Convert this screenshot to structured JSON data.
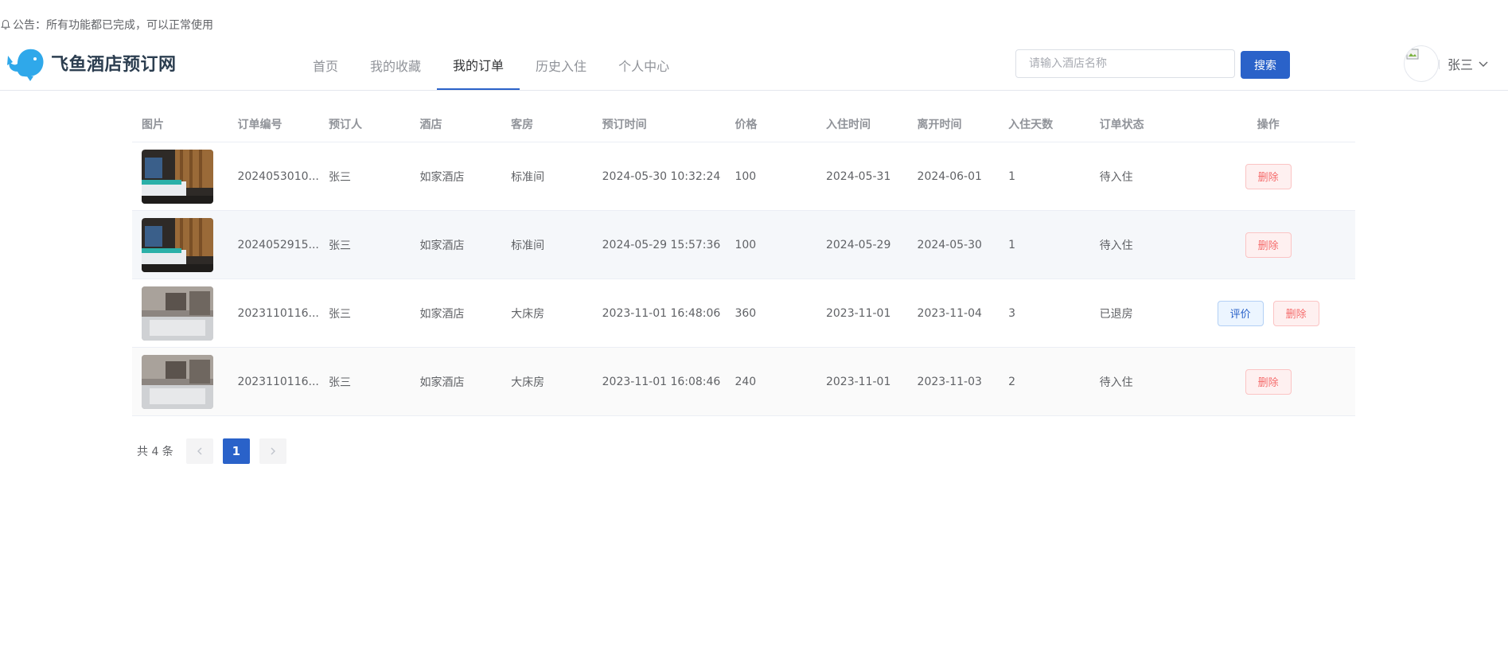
{
  "notice": {
    "text": "公告：所有功能都已完成，可以正常使用"
  },
  "brand": {
    "name": "飞鱼酒店预订网",
    "accent": "#2a62c9",
    "logo_color": "#2fa8ea"
  },
  "nav": [
    {
      "label": "首页",
      "active": false
    },
    {
      "label": "我的收藏",
      "active": false
    },
    {
      "label": "我的订单",
      "active": true
    },
    {
      "label": "历史入住",
      "active": false
    },
    {
      "label": "个人中心",
      "active": false
    }
  ],
  "search": {
    "placeholder": "请输入酒店名称",
    "value": "",
    "button": "搜索"
  },
  "user": {
    "name": "张三",
    "avatar_icon": "broken-image-icon",
    "menu_icon": "chevron-down-icon"
  },
  "table": {
    "headers": [
      "图片",
      "订单编号",
      "预订人",
      "酒店",
      "客房",
      "预订时间",
      "价格",
      "入住时间",
      "离开时间",
      "入住天数",
      "订单状态",
      "操作"
    ],
    "rows": [
      {
        "image": "standard-room",
        "order_no": "2024053010...",
        "guest": "张三",
        "hotel": "如家酒店",
        "room": "标准间",
        "booked": "2024-05-30 10:32:24",
        "price": "100",
        "checkin": "2024-05-31",
        "checkout": "2024-06-01",
        "days": "1",
        "status": "待入住",
        "actions": [
          "删除"
        ]
      },
      {
        "image": "standard-room",
        "order_no": "2024052915...",
        "guest": "张三",
        "hotel": "如家酒店",
        "room": "标准间",
        "booked": "2024-05-29 15:57:36",
        "price": "100",
        "checkin": "2024-05-29",
        "checkout": "2024-05-30",
        "days": "1",
        "status": "待入住",
        "actions": [
          "删除"
        ]
      },
      {
        "image": "king-room",
        "order_no": "2023110116...",
        "guest": "张三",
        "hotel": "如家酒店",
        "room": "大床房",
        "booked": "2023-11-01 16:48:06",
        "price": "360",
        "checkin": "2023-11-01",
        "checkout": "2023-11-04",
        "days": "3",
        "status": "已退房",
        "actions": [
          "评价",
          "删除"
        ]
      },
      {
        "image": "king-room",
        "order_no": "2023110116...",
        "guest": "张三",
        "hotel": "如家酒店",
        "room": "大床房",
        "booked": "2023-11-01 16:08:46",
        "price": "240",
        "checkin": "2023-11-01",
        "checkout": "2023-11-03",
        "days": "2",
        "status": "待入住",
        "actions": [
          "删除"
        ]
      }
    ]
  },
  "pagination": {
    "total_text": "共 4 条",
    "current_page": "1",
    "prev_icon": "chevron-left-icon",
    "next_icon": "chevron-right-icon"
  }
}
